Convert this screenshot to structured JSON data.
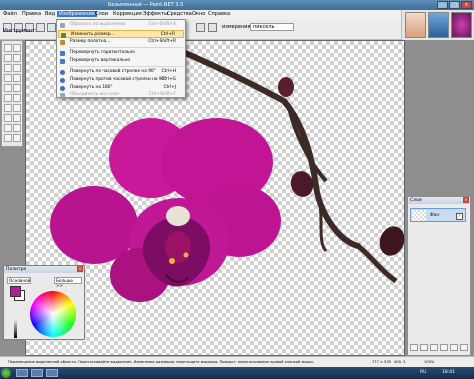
{
  "window": {
    "title": "Безымянный — Paint.NET 3.5"
  },
  "menubar": {
    "items": [
      {
        "label": "Файл"
      },
      {
        "label": "Правка"
      },
      {
        "label": "Вид"
      },
      {
        "label": "Изображение"
      },
      {
        "label": "Слои"
      },
      {
        "label": "Коррекция"
      },
      {
        "label": "Эффекты"
      },
      {
        "label": "Средства"
      },
      {
        "label": "Окно"
      },
      {
        "label": "Справка"
      }
    ]
  },
  "toolbar": {
    "tool_label": "Инструмент:",
    "dimensions_label": "измерения",
    "units_value": "пиксель"
  },
  "image_menu": {
    "items": [
      {
        "label": "Обрезать по выделению",
        "shortcut": "Ctrl+Shift+X",
        "disabled": true,
        "color": "#9aa4b0"
      },
      {
        "label": "Изменить размер...",
        "shortcut": "Ctrl+R",
        "highlighted": true,
        "color": "#4d8a3a"
      },
      {
        "label": "Размер полотна...",
        "shortcut": "Ctrl+Shift+R",
        "color": "#c98a2a"
      },
      {
        "label": "Перевернуть горизонтально",
        "shortcut": "",
        "color": "#4b7dc7"
      },
      {
        "label": "Перевернуть вертикально",
        "shortcut": "",
        "color": "#4b7dc7"
      },
      {
        "label": "Повернуть по часовой стрелке на 90°",
        "shortcut": "Ctrl+H",
        "color": "#3c6fb8"
      },
      {
        "label": "Повернуть против часовой стрелки на 90°",
        "shortcut": "Ctrl+G",
        "color": "#3c6fb8"
      },
      {
        "label": "Повернуть на 180°",
        "shortcut": "Ctrl+J",
        "color": "#3c6fb8"
      },
      {
        "label": "Объединить все слои",
        "shortcut": "Ctrl+Shift+F",
        "disabled": true,
        "color": "#9aa4b0"
      }
    ]
  },
  "palette": {
    "title": "Палитра",
    "mode_value": "Основной",
    "more_label": "Больше >>",
    "primary_color": "#b51a9f",
    "secondary_color": "#ffffff"
  },
  "layers": {
    "title": "Слои",
    "items": [
      {
        "name": "Фон",
        "visible": "✓"
      }
    ]
  },
  "statusbar": {
    "hint": "Перемещение выделенной области. Перетаскивайте выделение. Изменение размеров: перетащите маркеры. Поворот: перетаскивание правой кнопкой мыши.",
    "size": "777 × 535",
    "position": "400, 3",
    "zoom": "100%"
  },
  "taskbar": {
    "lang": "RU",
    "time": "18:41"
  },
  "colors": {
    "accent": "#3c77c6",
    "orchid": "#c9199b",
    "orchid_dark": "#7d0d62",
    "stem": "#3b2a26"
  }
}
